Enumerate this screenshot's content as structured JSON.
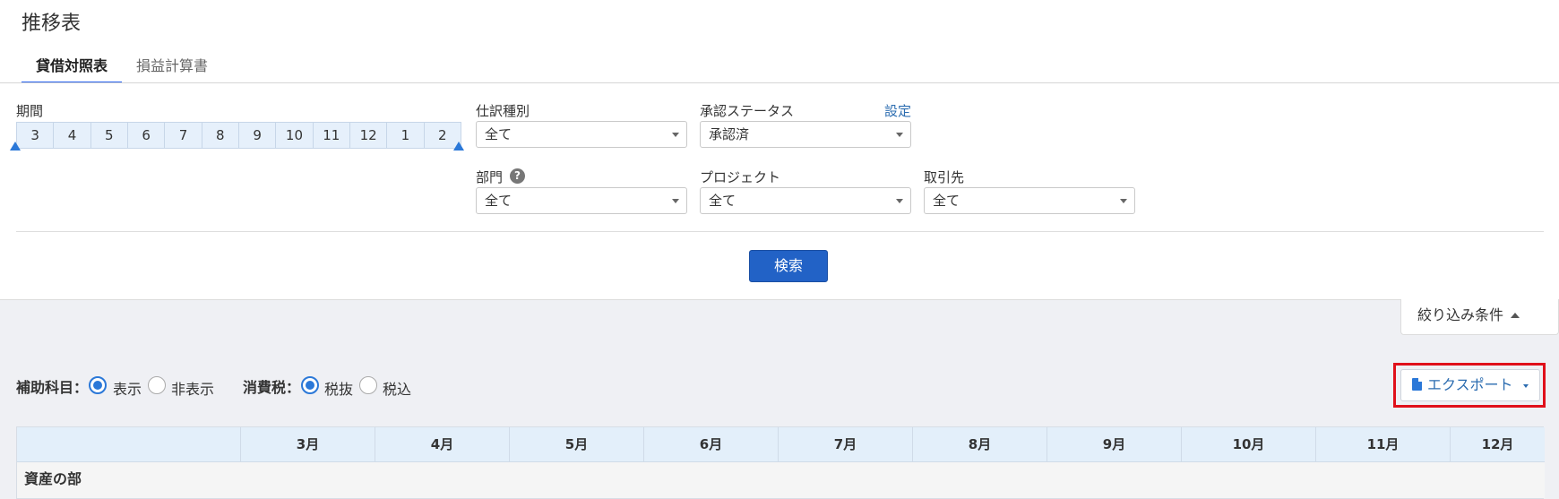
{
  "page": {
    "title": "推移表"
  },
  "tabs": [
    {
      "label": "貸借対照表",
      "active": true
    },
    {
      "label": "損益計算書",
      "active": false
    }
  ],
  "filters": {
    "period": {
      "label": "期間",
      "months": [
        "3",
        "4",
        "5",
        "6",
        "7",
        "8",
        "9",
        "10",
        "11",
        "12",
        "1",
        "2"
      ]
    },
    "journal_type": {
      "label": "仕訳種別",
      "value": "全て"
    },
    "approval_status": {
      "label": "承認ステータス",
      "value": "承認済",
      "settings_link": "設定"
    },
    "department": {
      "label": "部門",
      "value": "全て",
      "help": "?"
    },
    "project": {
      "label": "プロジェクト",
      "value": "全て"
    },
    "partner": {
      "label": "取引先",
      "value": "全て"
    },
    "search_button": "検索",
    "toggle_label": "絞り込み条件"
  },
  "options": {
    "sub_account": {
      "label": "補助科目：",
      "choices": [
        "表示",
        "非表示"
      ],
      "selected": "表示"
    },
    "tax": {
      "label": "消費税：",
      "choices": [
        "税抜",
        "税込"
      ],
      "selected": "税抜"
    }
  },
  "export": {
    "label": "エクスポート"
  },
  "table": {
    "columns": [
      "3月",
      "4月",
      "5月",
      "6月",
      "7月",
      "8月",
      "9月",
      "10月",
      "11月",
      "12月"
    ],
    "rows": [
      {
        "label": "資産の部"
      }
    ]
  },
  "colors": {
    "accent": "#2262c6",
    "highlight": "#e0101a",
    "header_bg": "#e3effa"
  }
}
